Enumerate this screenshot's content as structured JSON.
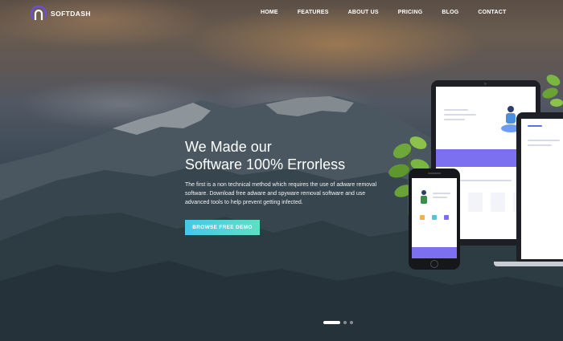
{
  "brand": {
    "name": "SOFTDASH",
    "logo_icon": "arch-logo-icon"
  },
  "nav": {
    "items": [
      {
        "label": "HOME"
      },
      {
        "label": "FEATURES"
      },
      {
        "label": "ABOUT US"
      },
      {
        "label": "PRICING"
      },
      {
        "label": "BLOG"
      },
      {
        "label": "CONTACT"
      }
    ]
  },
  "hero": {
    "headline_line1": "We Made our",
    "headline_line2": "Software 100% Errorless",
    "description": "The first is a non technical method which requires the use of adware removal software. Download free adware and spyware removal software and use advanced tools to help prevent getting infected.",
    "cta_label": "BROWSE FREE DEMO"
  },
  "slider": {
    "total": 3,
    "active": 1
  },
  "colors": {
    "accent_gradient_start": "#45c8ea",
    "accent_gradient_end": "#5fdfc4",
    "device_accent": "#7c6ff0",
    "logo_purple": "#6b4fd8"
  }
}
